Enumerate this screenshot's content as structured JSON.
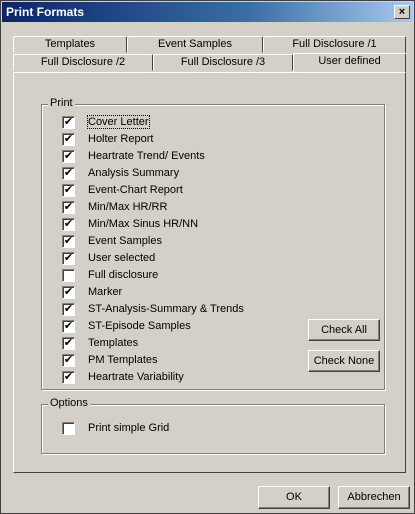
{
  "window": {
    "title": "Print Formats",
    "close_symbol": "×"
  },
  "tabs": {
    "row1": [
      "Templates",
      "Event Samples",
      "Full Disclosure /1"
    ],
    "row2": [
      "Full Disclosure /2",
      "Full Disclosure /3",
      "User defined"
    ],
    "active": "User defined"
  },
  "print_group": {
    "label": "Print",
    "items": [
      {
        "label": "Cover Letter",
        "checked": true
      },
      {
        "label": "Holter Report",
        "checked": true
      },
      {
        "label": "Heartrate Trend/ Events",
        "checked": true
      },
      {
        "label": "Analysis Summary",
        "checked": true
      },
      {
        "label": "Event-Chart Report",
        "checked": true
      },
      {
        "label": "Min/Max HR/RR",
        "checked": true
      },
      {
        "label": "Min/Max Sinus HR/NN",
        "checked": true
      },
      {
        "label": "Event Samples",
        "checked": true
      },
      {
        "label": "User selected",
        "checked": true
      },
      {
        "label": "Full disclosure",
        "checked": false
      },
      {
        "label": "Marker",
        "checked": true
      },
      {
        "label": "ST-Analysis-Summary & Trends",
        "checked": true
      },
      {
        "label": "ST-Episode Samples",
        "checked": true
      },
      {
        "label": "Templates",
        "checked": true
      },
      {
        "label": "PM Templates",
        "checked": true
      },
      {
        "label": "Heartrate Variability",
        "checked": true
      }
    ],
    "check_all_label": "Check All",
    "check_none_label": "Check None"
  },
  "options_group": {
    "label": "Options",
    "items": [
      {
        "label": "Print simple Grid",
        "checked": false
      }
    ]
  },
  "footer": {
    "ok_label": "OK",
    "cancel_label": "Abbrechen"
  }
}
